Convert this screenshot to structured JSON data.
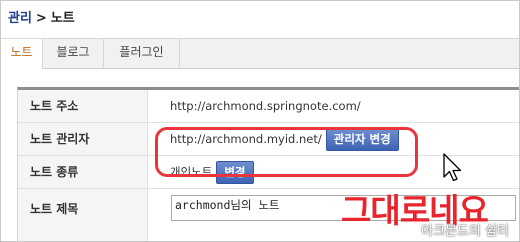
{
  "breadcrumb": {
    "root": "관리",
    "separator": ">",
    "current": "노트"
  },
  "tabs": [
    {
      "label": "노트",
      "active": true
    },
    {
      "label": "블로그",
      "active": false
    },
    {
      "label": "플러그인",
      "active": false
    }
  ],
  "settings": {
    "note_address": {
      "label": "노트 주소",
      "value": "http://archmond.springnote.com/"
    },
    "note_manager": {
      "label": "노트 관리자",
      "value": "http://archmond.myid.net/",
      "button": "관리자 변경"
    },
    "note_type": {
      "label": "노트 종류",
      "value": "개인노트",
      "button": "변경"
    },
    "note_title": {
      "label": "노트 제목",
      "value": "archmond님의 노트"
    }
  },
  "annotation": {
    "text": "그대로네요",
    "color": "#e8242c"
  },
  "watermark": "아크몬드의 쉼터",
  "colors": {
    "active_tab_text": "#c06a1b",
    "button_bg": "#4a6cc0",
    "highlight": "#e8363c"
  }
}
